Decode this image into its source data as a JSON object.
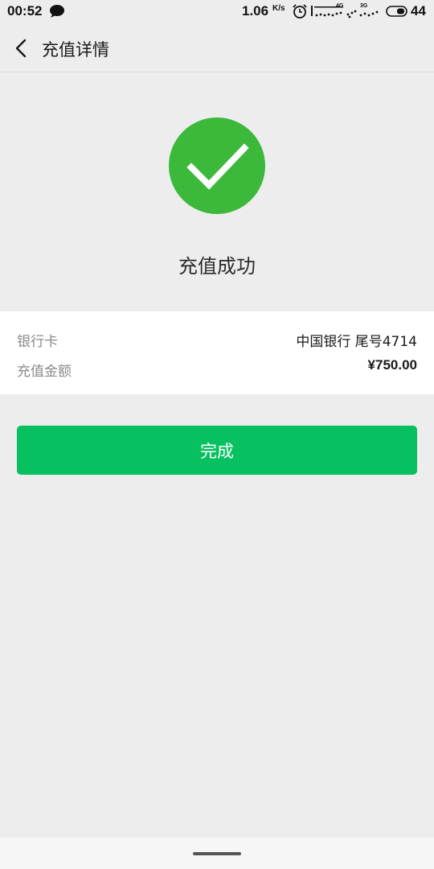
{
  "status_bar": {
    "time": "00:52",
    "network_speed": "1.06",
    "network_speed_unit": "K/s",
    "signal_1_label": "4G",
    "signal_2_label": "3G",
    "battery_level": "44",
    "icons": [
      "chat-bubble-icon",
      "alarm-icon",
      "signal-icon",
      "battery-icon"
    ]
  },
  "nav": {
    "back_icon": "chevron-left-icon",
    "title": "充值详情"
  },
  "result": {
    "icon": "checkmark-circle-icon",
    "title": "充值成功"
  },
  "details": {
    "bank_label": "银行卡",
    "bank_value": "中国银行 尾号4714",
    "amount_label": "充值金额",
    "amount_value": "¥750.00"
  },
  "actions": {
    "done_label": "完成"
  },
  "colors": {
    "accent": "#07c160",
    "success_icon": "#3cb93a",
    "background": "#ededed",
    "card": "#ffffff"
  }
}
